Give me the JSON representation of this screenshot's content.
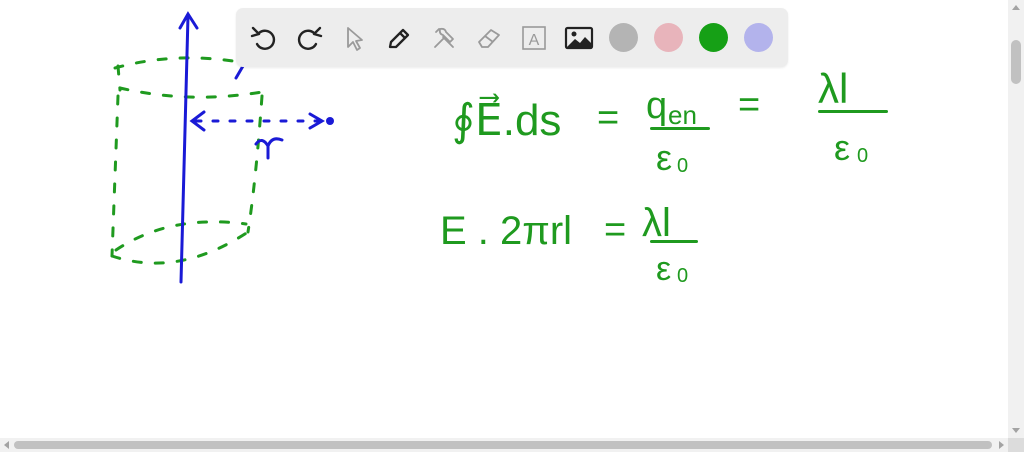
{
  "toolbar": {
    "tools": [
      {
        "name": "undo-icon",
        "label": "Undo",
        "enabled": true
      },
      {
        "name": "redo-icon",
        "label": "Redo",
        "enabled": true
      },
      {
        "name": "select-pointer-icon",
        "label": "Select",
        "enabled": false
      },
      {
        "name": "pen-icon",
        "label": "Pen",
        "enabled": true
      },
      {
        "name": "tools-icon",
        "label": "Tools",
        "enabled": false
      },
      {
        "name": "eraser-icon",
        "label": "Eraser",
        "enabled": false
      },
      {
        "name": "text-box-icon",
        "label": "Text",
        "enabled": false
      },
      {
        "name": "image-icon",
        "label": "Insert image",
        "enabled": true
      }
    ],
    "colors": [
      {
        "name": "gray",
        "hex": "#b4b4b4",
        "selected": false
      },
      {
        "name": "pink",
        "hex": "#e8b4bb",
        "selected": false
      },
      {
        "name": "green",
        "hex": "#16a016",
        "selected": true
      },
      {
        "name": "lavender",
        "hex": "#b3b3ec",
        "selected": false
      }
    ],
    "text_tool_glyph": "A"
  },
  "ink": {
    "green": "#1f9a1f",
    "blue": "#1a1ad6"
  },
  "handwriting": {
    "radius_label": "r",
    "gauss_law": {
      "lhs": "∮E⃗.ds",
      "eq1": "=",
      "numerator1": "q",
      "numerator1_sub": "en",
      "denominator1": "ε",
      "denominator1_sub": "0",
      "eq2": "=",
      "numerator2": "λl",
      "denominator2": "ε",
      "denominator2_sub": "0"
    },
    "result": {
      "lhs": "E . 2πrl",
      "eq": "=",
      "numerator": "λl",
      "denominator": "ε",
      "denominator_sub": "0"
    }
  }
}
